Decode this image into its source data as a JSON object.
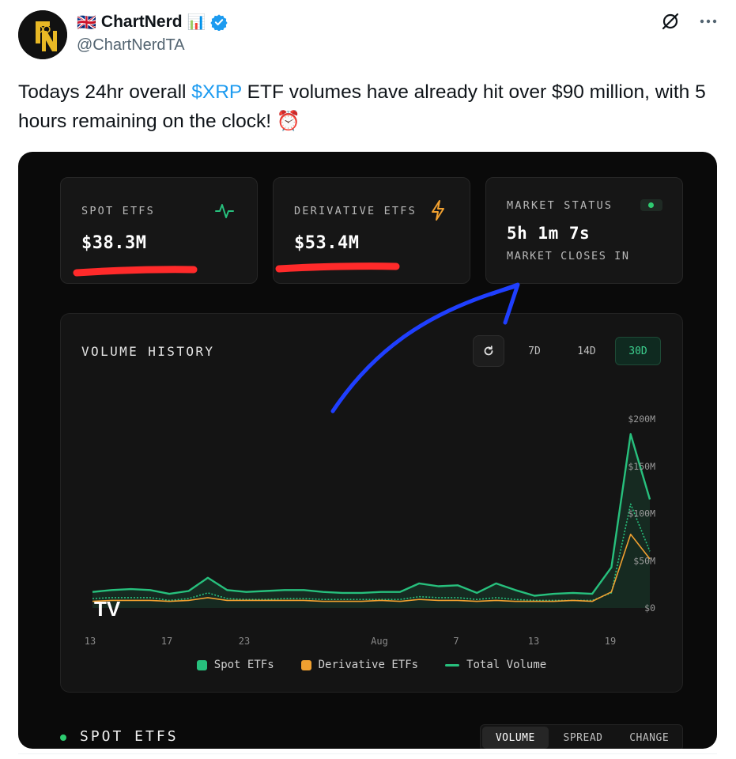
{
  "tweet": {
    "flag_emoji": "🇬🇧",
    "display_name": "ChartNerd",
    "chart_emoji": "📊",
    "handle": "@ChartNerdTA",
    "text_before": "Todays 24hr overall ",
    "cashtag": "$XRP",
    "text_after": " ETF volumes have already hit over $90 million, with 5 hours remaining on the clock! ",
    "alarm_emoji": "⏰",
    "colors": {
      "link": "#1d9bf0",
      "verified": "#1d9bf0"
    }
  },
  "dashboard": {
    "cards": {
      "spot": {
        "label": "SPOT ETFS",
        "value": "$38.3M",
        "icon": "activity-icon"
      },
      "derivative": {
        "label": "DERIVATIVE ETFS",
        "value": "$53.4M",
        "icon": "lightning-icon"
      },
      "market": {
        "label": "MARKET STATUS",
        "value": "5h 1m 7s",
        "sublabel": "MARKET CLOSES IN",
        "status_color": "#2ecc71"
      }
    },
    "history": {
      "title": "VOLUME HISTORY",
      "ranges": [
        "7D",
        "14D",
        "30D"
      ],
      "active_range": "30D",
      "legend": [
        "Spot ETFs",
        "Derivative ETFs",
        "Total Volume"
      ],
      "watermark": "TV"
    },
    "section": {
      "title": "SPOT ETFS",
      "tabs": [
        "VOLUME",
        "SPREAD",
        "CHANGE"
      ],
      "active_tab": "VOLUME"
    },
    "colors": {
      "spot": "#27c07d",
      "derivative": "#f0a030",
      "total": "#27c07d",
      "accent": "#3ccf8e"
    }
  },
  "chart_data": {
    "type": "area",
    "title": "VOLUME HISTORY",
    "x_tick_labels": [
      "13",
      "17",
      "23",
      "Aug",
      "7",
      "13",
      "19"
    ],
    "y_tick_labels": [
      "$200M",
      "$150M",
      "$100M",
      "$50M",
      "$0"
    ],
    "ylim": [
      0,
      200
    ],
    "y_unit": "$M",
    "series": [
      {
        "name": "Spot ETFs",
        "values": [
          10,
          11,
          11,
          11,
          8,
          10,
          16,
          10,
          9,
          9,
          10,
          10,
          9,
          9,
          9,
          9,
          9,
          12,
          11,
          11,
          9,
          11,
          9,
          8,
          8,
          8,
          8,
          16,
          110,
          60
        ]
      },
      {
        "name": "Derivative ETFs",
        "values": [
          7,
          8,
          8,
          8,
          7,
          8,
          11,
          8,
          8,
          8,
          8,
          8,
          7,
          7,
          7,
          8,
          7,
          9,
          8,
          8,
          7,
          8,
          7,
          7,
          7,
          8,
          7,
          17,
          78,
          52
        ]
      },
      {
        "name": "Total Volume",
        "values": [
          17,
          19,
          20,
          19,
          15,
          18,
          32,
          19,
          17,
          18,
          19,
          19,
          17,
          16,
          16,
          17,
          17,
          26,
          23,
          24,
          16,
          26,
          19,
          13,
          15,
          16,
          15,
          43,
          184,
          115
        ]
      }
    ],
    "grid": false,
    "legend_position": "bottom-center"
  },
  "annotations": {
    "underline_color": "#ff2a2a",
    "arrow_color": "#1f3fff"
  }
}
